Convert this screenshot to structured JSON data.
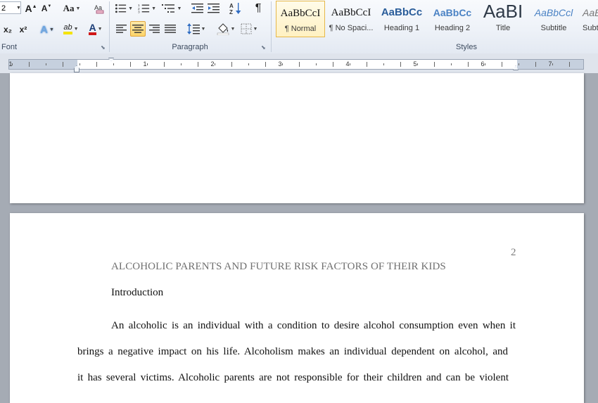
{
  "ribbon": {
    "font_group": {
      "label": "Font",
      "font_size": "2",
      "grow_font": "A",
      "shrink_font": "A",
      "change_case": "Aa",
      "subscript": "x₂",
      "superscript": "x²",
      "text_effects": "A",
      "highlight_text": "ab",
      "font_color": "A"
    },
    "paragraph_group": {
      "label": "Paragraph",
      "pilcrow": "¶"
    },
    "styles_group": {
      "label": "Styles",
      "styles": [
        {
          "preview": "AaBbCcI",
          "name": "¶ Normal"
        },
        {
          "preview": "AaBbCcI",
          "name": "¶ No Spaci..."
        },
        {
          "preview": "AaBbCc",
          "name": "Heading 1"
        },
        {
          "preview": "AaBbCc",
          "name": "Heading 2"
        },
        {
          "preview": "AaBI",
          "name": "Title"
        },
        {
          "preview": "AaBbCcl",
          "name": "Subtitle"
        },
        {
          "preview": "AaB",
          "name": "Subt"
        }
      ]
    },
    "colors": {
      "highlight": "#f5e400",
      "font_color": "#d01818",
      "heading_blue": "#2a5d9a"
    }
  },
  "ruler": {
    "numbers": [
      "1",
      "1",
      "2",
      "3",
      "4",
      "5",
      "6",
      "7"
    ]
  },
  "document": {
    "page_number": "2",
    "running_head": "ALCOHOLIC PARENTS AND FUTURE RISK FACTORS OF THEIR KIDS",
    "heading": "Introduction",
    "lines": [
      "An alcoholic is an individual with a condition to desire alcohol consumption even when it",
      "brings a negative impact on his life. Alcoholism makes an individual dependent on alcohol, and",
      "it has several victims. Alcoholic parents are not responsible for their children and can be violent"
    ]
  }
}
